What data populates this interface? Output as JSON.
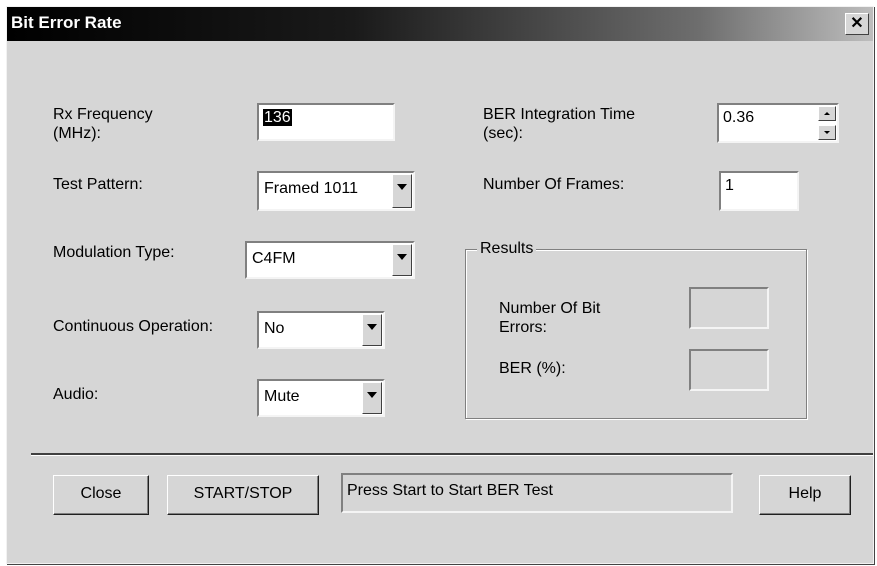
{
  "window": {
    "title": "Bit Error Rate",
    "close_glyph": "✕"
  },
  "left": {
    "rx_frequency_label": "Rx Frequency\n(MHz):",
    "rx_frequency_value": "136",
    "test_pattern_label": "Test Pattern:",
    "test_pattern_value": "Framed 1011",
    "modulation_label": "Modulation Type:",
    "modulation_value": "C4FM",
    "continuous_label": "Continuous Operation:",
    "continuous_value": "No",
    "audio_label": "Audio:",
    "audio_value": "Mute"
  },
  "right": {
    "integration_label": "BER Integration Time\n(sec):",
    "integration_value": "0.36",
    "frames_label": "Number Of Frames:",
    "frames_value": "1"
  },
  "results": {
    "title": "Results",
    "bit_errors_label": "Number Of Bit\nErrors:",
    "bit_errors_value": "",
    "ber_label": "BER (%):",
    "ber_value": ""
  },
  "footer": {
    "close_label": "Close",
    "start_stop_label": "START/STOP",
    "status_text": "Press Start to Start BER Test",
    "help_label": "Help"
  },
  "icons": [
    "close-icon",
    "dropdown-arrow-icon",
    "spin-up-icon",
    "spin-down-icon"
  ]
}
